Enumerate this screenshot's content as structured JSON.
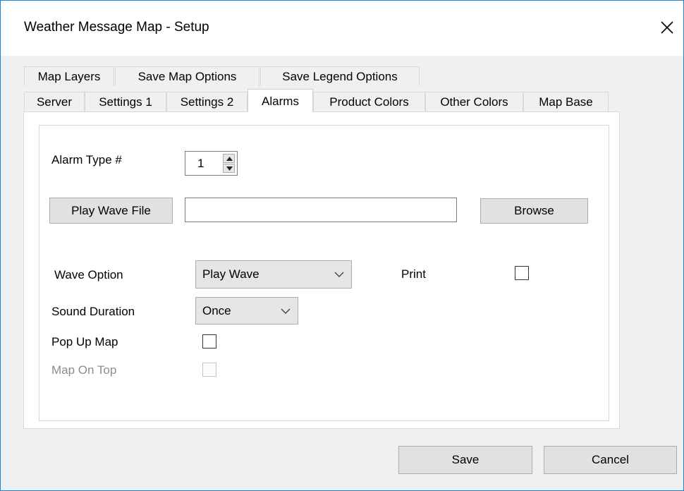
{
  "window": {
    "title": "Weather Message Map - Setup",
    "close_glyph": "✕"
  },
  "tabs": {
    "row1": [
      "Map Layers",
      "Save Map Options",
      "Save Legend Options"
    ],
    "row2": [
      "Server",
      "Settings 1",
      "Settings 2",
      "Alarms",
      "Product Colors",
      "Other Colors",
      "Map Base"
    ],
    "active": "Alarms"
  },
  "alarms": {
    "alarm_type_label": "Alarm Type #",
    "alarm_type_value": "1",
    "play_wave_button": "Play Wave File",
    "wave_file_value": "",
    "browse_button": "Browse",
    "wave_option_label": "Wave Option",
    "wave_option_value": "Play Wave",
    "print_label": "Print",
    "print_checked": false,
    "sound_duration_label": "Sound Duration",
    "sound_duration_value": "Once",
    "popup_map_label": "Pop  Up Map",
    "popup_map_checked": false,
    "map_on_top_label": "Map On Top",
    "map_on_top_checked": false
  },
  "footer": {
    "save_button": "Save",
    "cancel_button": "Cancel"
  },
  "icons": {
    "close": "close-icon",
    "spin_up": "arrow-up-icon",
    "spin_down": "arrow-down-icon",
    "combo": "chevron-down-icon"
  }
}
